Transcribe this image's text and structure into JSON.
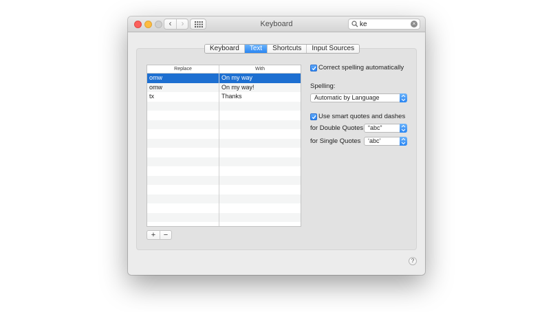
{
  "window": {
    "title": "Keyboard"
  },
  "toolbar": {
    "back_glyph": "‹",
    "forward_glyph": "›",
    "search_value": "ke",
    "search_clear_glyph": "×"
  },
  "tabs": [
    "Keyboard",
    "Text",
    "Shortcuts",
    "Input Sources"
  ],
  "active_tab": "Text",
  "replacements": {
    "header_replace": "Replace",
    "header_with": "With",
    "rows": [
      {
        "replace": "omw",
        "with": "On my way",
        "selected": true
      },
      {
        "replace": "omw",
        "with": "On my way!",
        "selected": false
      },
      {
        "replace": "tx",
        "with": "Thanks",
        "selected": false
      }
    ],
    "add_glyph": "+",
    "remove_glyph": "−"
  },
  "options": {
    "correct_spelling_label": "Correct spelling automatically",
    "correct_spelling_checked": true,
    "spelling_label": "Spelling:",
    "spelling_value": "Automatic by Language",
    "smart_quotes_label": "Use smart quotes and dashes",
    "smart_quotes_checked": true,
    "double_quotes_label": "for Double Quotes",
    "double_quotes_value": "“abc”",
    "single_quotes_label": "for Single Quotes",
    "single_quotes_value": "‘abc’"
  },
  "help_glyph": "?",
  "colors": {
    "accent": "#2a86f3",
    "selection": "#1d6fd1",
    "close": "#fc605c",
    "minimize": "#fdbc40"
  }
}
